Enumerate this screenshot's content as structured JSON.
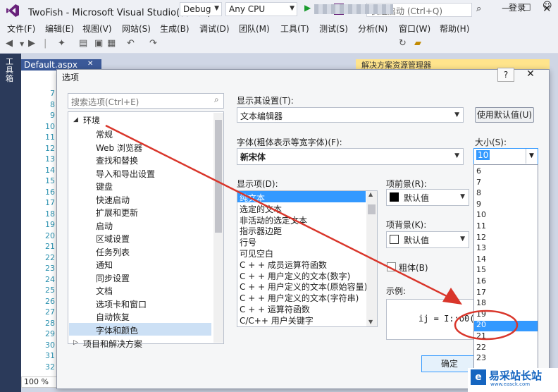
{
  "window": {
    "title": "TwoFish - Microsoft Visual Studio(管理员)",
    "notification_count": "3",
    "quick_launch_placeholder": "快速启动 (Ctrl+Q)"
  },
  "menu": [
    "文件(F)",
    "编辑(E)",
    "视图(V)",
    "网站(S)",
    "生成(B)",
    "调试(D)",
    "团队(M)",
    "工具(T)",
    "测试(S)",
    "分析(N)",
    "窗口(W)",
    "帮助(H)"
  ],
  "login": "登录",
  "toolbar": {
    "config": "Debug",
    "platform": "Any CPU"
  },
  "left_strip": {
    "toolbox": "工具箱"
  },
  "editor": {
    "tab": "Default.aspx",
    "line_numbers": [
      "7",
      "8",
      "9",
      "10",
      "11",
      "12",
      "13",
      "14",
      "15",
      "16",
      "17",
      "18",
      "19",
      "20",
      "21",
      "22",
      "23",
      "24",
      "25",
      "26",
      "27",
      "28",
      "29",
      "30",
      "31",
      "32"
    ],
    "zoom": "100 %"
  },
  "solution_explorer": {
    "title": "解决方案资源管理器"
  },
  "dialog": {
    "title": "选项",
    "help": "?",
    "search_placeholder": "搜索选项(Ctrl+E)",
    "tree_root": "环境",
    "tree_items": [
      "常规",
      "Web 浏览器",
      "查找和替换",
      "导入和导出设置",
      "键盘",
      "快速启动",
      "扩展和更新",
      "启动",
      "区域设置",
      "任务列表",
      "通知",
      "同步设置",
      "文档",
      "选项卡和窗口",
      "自动恢复",
      "字体和颜色"
    ],
    "tree_next": "项目和解决方案",
    "show_settings_label": "显示其设置(T):",
    "show_settings_value": "文本编辑器",
    "use_defaults": "使用默认值(U)",
    "font_label": "字体(粗体表示等宽字体)(F):",
    "font_value": "新宋体",
    "size_label": "大小(S):",
    "size_value": "10",
    "display_items_label": "显示项(D):",
    "display_items": [
      "纯文本",
      "选定的文本",
      "非活动的选定文本",
      "指示器边距",
      "行号",
      "可见空白",
      "C + + 成员运算符函数",
      "C + + 用户定义的文本(数字)",
      "C + + 用户定义的文本(原始容量)",
      "C + + 用户定义的文本(字符串)",
      "C + + 运算符函数",
      "C/C++ 用户关键字"
    ],
    "fg_label": "项前景(R):",
    "fg_value": "默认值",
    "bg_label": "项背景(K):",
    "bg_value": "默认值",
    "bold_label": "粗体(B)",
    "sample_label": "示例:",
    "sample_text": "ij = I::o0(0",
    "ok": "确定",
    "size_options": [
      "6",
      "7",
      "8",
      "9",
      "10",
      "11",
      "12",
      "13",
      "14",
      "15",
      "16",
      "17",
      "18",
      "19",
      "20",
      "21",
      "22",
      "23"
    ],
    "size_selected": "20"
  },
  "annotation": {
    "arrow_color": "#d9362b",
    "circle_color": "#d9362b"
  },
  "watermark": {
    "logo": "e",
    "text": "易采站长站",
    "sub": "www.easck.com"
  }
}
